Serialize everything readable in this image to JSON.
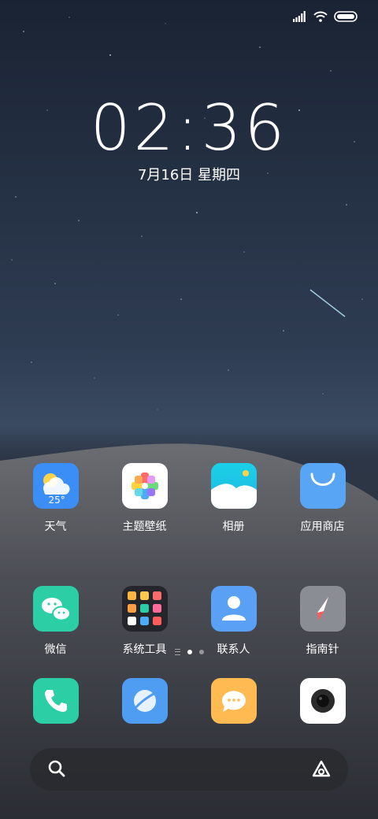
{
  "status_bar": {
    "signal_icon": "signal-icon",
    "wifi_icon": "wifi-icon",
    "battery_icon": "battery-icon"
  },
  "lockscreen_widget": {
    "time": "02:36",
    "date": "7月16日 星期四"
  },
  "apps": [
    {
      "name": "weather",
      "label": "天气",
      "temp": "25°",
      "color": "#3a8ef6"
    },
    {
      "name": "themes",
      "label": "主题壁纸",
      "color": "#ffffff"
    },
    {
      "name": "gallery",
      "label": "相册",
      "color": "#1fc8e6"
    },
    {
      "name": "app-store",
      "label": "应用商店",
      "color": "#58a4f5"
    },
    {
      "name": "wechat",
      "label": "微信",
      "color": "#2ccfa5"
    },
    {
      "name": "system-tools",
      "label": "系统工具",
      "color": "#2a2d33"
    },
    {
      "name": "contacts",
      "label": "联系人",
      "color": "#5aa0f5"
    },
    {
      "name": "compass",
      "label": "指南针",
      "color": "#8a8d93"
    }
  ],
  "page_indicator": {
    "pages": 2,
    "current": 1
  },
  "dock": [
    {
      "name": "phone",
      "color": "#2ccfa5"
    },
    {
      "name": "browser",
      "color": "#4f9df3"
    },
    {
      "name": "messages",
      "color": "#ffba52"
    },
    {
      "name": "camera",
      "color": "#ffffff"
    }
  ],
  "search_bar": {
    "search_icon": "search-icon",
    "assistant_icon": "assistant-icon"
  }
}
